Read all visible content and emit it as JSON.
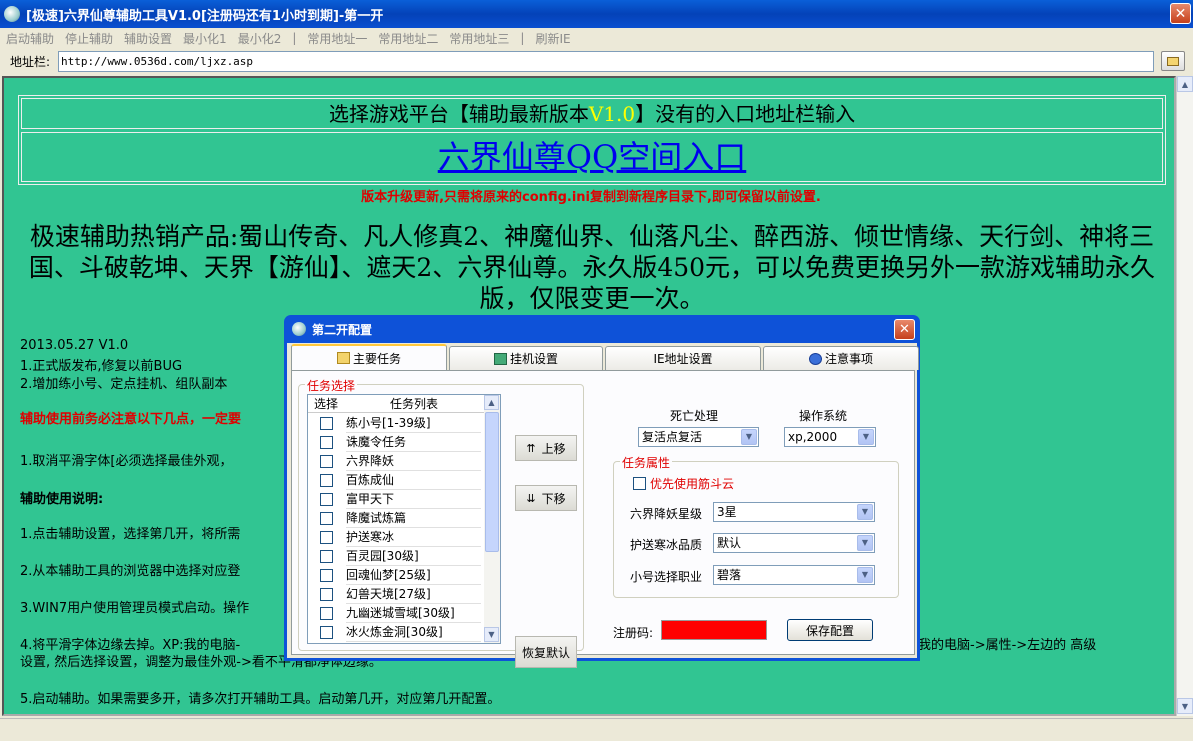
{
  "window": {
    "title": "[极速]六界仙尊辅助工具V1.0[注册码还有1小时到期]-第一开",
    "close_glyph": "✕"
  },
  "menu": [
    "启动辅助",
    "停止辅助",
    "辅助设置",
    "最小化1",
    "最小化2",
    "|",
    "常用地址一",
    "常用地址二",
    "常用地址三",
    "|",
    "刷新IE"
  ],
  "address": {
    "label": "地址栏:",
    "url": "http://www.0536d.com/ljxz.asp"
  },
  "page": {
    "header_pre": "选择游戏平台【辅助最新版本",
    "header_ver": "V1.0",
    "header_post": "】没有的入口地址栏输入",
    "entry_link": "六界仙尊QQ空间入口",
    "upgrade_note": "版本升级更新,只需将原来的config.ini复制到新程序目录下,即可保留以前设置.",
    "hot_products": "极速辅助热销产品:蜀山传奇、凡人修真2、神魔仙界、仙落凡尘、醉西游、倾世情缘、天行剑、神将三国、斗破乾坤、天界【游仙】、遮天2、六界仙尊。永久版450元，可以免费更换另外一款游戏辅助永久版，仅限变更一次。",
    "notes": {
      "date": "2013.05.27 V1.0",
      "n1": "1.正式版发布,修复以前BUG",
      "n2": "2.增加练小号、定点挂机、组队副本",
      "warn": "辅助使用前务必注意以下几点，一定要",
      "s1": "1.取消平滑字体[必须选择最佳外观，",
      "usage_title": "辅助使用说明:",
      "u1": "1.点击辅助设置，选择第几开，将所需",
      "u2": "2.从本辅助工具的浏览器中选择对应登",
      "u3": "3.WIN7用户使用管理员模式启动。操作",
      "u4a": "4.将平滑字体边缘去掉。XP:我的电脑-",
      "u4b": "键我的电脑->属性->左边的 高级",
      "u4c": "设置, 然后选择设置，调整为最佳外观->看不平滑都净体边缘。",
      "u5": "5.启动辅助。如果需要多开，请多次打开辅助工具。启动第几开，对应第几开配置。"
    }
  },
  "dialog": {
    "title": "第二开配置",
    "close_glyph": "✕",
    "tabs": [
      "主要任务",
      "挂机设置",
      "IE地址设置",
      "注意事项"
    ],
    "task_group_label": "任务选择",
    "list_headers": [
      "选择",
      "任务列表"
    ],
    "tasks": [
      "练小号[1-39级]",
      "诛魔令任务",
      "六界降妖",
      "百炼成仙",
      "富甲天下",
      "降魔试炼篇",
      "护送寒冰",
      "百灵园[30级]",
      "回魂仙梦[25级]",
      "幻兽天境[27级]",
      "九幽迷城雪域[30级]",
      "冰火炼金洞[30级]"
    ],
    "buttons": {
      "up": "上移",
      "down": "下移",
      "restore": "恢复默认",
      "save": "保存配置"
    },
    "death_label": "死亡处理",
    "death_value": "复活点复活",
    "os_label": "操作系统",
    "os_value": "xp,2000",
    "attr_group_label": "任务属性",
    "prefer_cloud": "优先使用筋斗云",
    "star_label": "六界降妖星级",
    "star_value": "3星",
    "escort_label": "护送寒冰品质",
    "escort_value": "默认",
    "job_label": "小号选择职业",
    "job_value": "碧落",
    "reg_label": "注册码:",
    "reg_color": "#ff0000"
  },
  "colors": {
    "page_bg": "#31c592",
    "title_blue": "#0a4fd0",
    "link": "#0000ee",
    "warn_red": "#e00000",
    "version_yellow": "#ffff00"
  }
}
